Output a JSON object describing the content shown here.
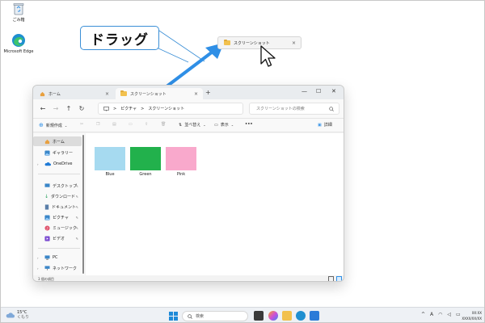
{
  "desktop": {
    "icons": [
      {
        "label": "ごみ箱",
        "icon": "recycle-bin-icon"
      },
      {
        "label": "Microsoft Edge",
        "icon": "edge-browser-icon"
      }
    ]
  },
  "callout": {
    "text": "ドラッグ"
  },
  "drag_item": {
    "label": "スクリーンショット",
    "close": "×"
  },
  "explorer": {
    "tabs": [
      {
        "label": "ホーム",
        "close": "×"
      },
      {
        "label": "スクリーンショット",
        "close": "×"
      }
    ],
    "new_tab": "+",
    "window_controls": {
      "minimize": "—",
      "maximize": "☐",
      "close": "✕"
    },
    "breadcrumb": [
      "ピクチャ",
      "スクリーンショット"
    ],
    "breadcrumb_sep": ">",
    "search_placeholder": "スクリーンショットの検索",
    "commands": {
      "new": "新規作成",
      "sort": "並べ替え",
      "view": "表示",
      "more": "•••",
      "details": "詳細"
    },
    "sidebar": [
      {
        "label": "ホーム",
        "icon": "home-icon",
        "selected": true
      },
      {
        "label": "ギャラリー",
        "icon": "gallery-icon"
      },
      {
        "label": "OneDrive",
        "icon": "onedrive-icon"
      },
      {
        "label": "デスクトップ",
        "icon": "desktop-icon"
      },
      {
        "label": "ダウンロード",
        "icon": "download-icon"
      },
      {
        "label": "ドキュメント",
        "icon": "document-icon"
      },
      {
        "label": "ピクチャ",
        "icon": "pictures-icon"
      },
      {
        "label": "ミュージック",
        "icon": "music-icon"
      },
      {
        "label": "ビデオ",
        "icon": "video-icon"
      },
      {
        "label": "PC",
        "icon": "pc-icon"
      },
      {
        "label": "ネットワーク",
        "icon": "network-icon"
      }
    ],
    "files": [
      {
        "name": "Blue",
        "color": "#a6daf0"
      },
      {
        "name": "Green",
        "color": "#22b14c"
      },
      {
        "name": "Pink",
        "color": "#f9a9cc"
      }
    ],
    "status": "3 個の項目"
  },
  "taskbar": {
    "weather_temp": "15°C",
    "weather_cond": "くもり",
    "search_placeholder": "検索",
    "tray_ime": "A",
    "clock_time": "XX:XX",
    "clock_date": "XXXX/XX/XX"
  },
  "colors": {
    "accent": "#2f8fe6",
    "callout_border": "#3b8fd6"
  }
}
